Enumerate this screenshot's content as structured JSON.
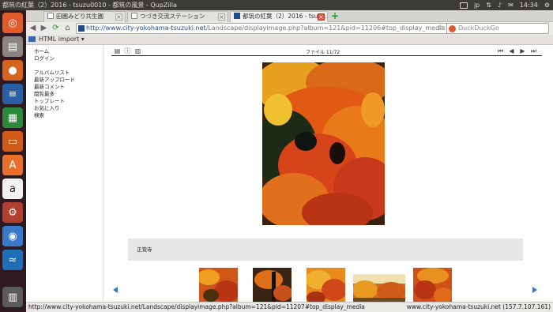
{
  "system": {
    "window_title": "都筑の紅葉（2）2016 - tsuzu0010 - 都筑の風景 - QupZilla",
    "keyboard": "jp",
    "clock": "14:34"
  },
  "tabs": [
    {
      "label": "田園みどり共生園"
    },
    {
      "label": "つづき交流ステーション"
    },
    {
      "label": "都筑の紅葉（2）2016 - tsuz…"
    }
  ],
  "new_tab_label": "+",
  "url": {
    "site": "http://www.city-yokohama-tsuzuki.net",
    "path": "/Landscape/displayimage.php?album=121&pid=11206#top_display_media"
  },
  "search": {
    "placeholder": "DuckDuckGo"
  },
  "bookmarks": {
    "item": "HTML import"
  },
  "sidebar": {
    "items": [
      {
        "label": "ホーム"
      },
      {
        "label": "ログイン"
      },
      {
        "label": "アルバムリスト"
      },
      {
        "label": "最新アップロード"
      },
      {
        "label": "最新コメント"
      },
      {
        "label": "閲覧最多"
      },
      {
        "label": "トップレート"
      },
      {
        "label": "お気に入り"
      },
      {
        "label": "検索"
      }
    ]
  },
  "viewer": {
    "counter": "ファイル 11/72",
    "caption": "正覚寺"
  },
  "status": {
    "link": "http://www.city-yokohama-tsuzuki.net/Landscape/displayimage.php?album=121&pid=11207#top_display_media",
    "server": "www.city-yokohama-tsuzuki.net (157.7.107.161)"
  },
  "colors": {
    "accent": "#1e4a8a",
    "launcher_bg": "#2f1a22",
    "arrow": "#2f79c6"
  }
}
